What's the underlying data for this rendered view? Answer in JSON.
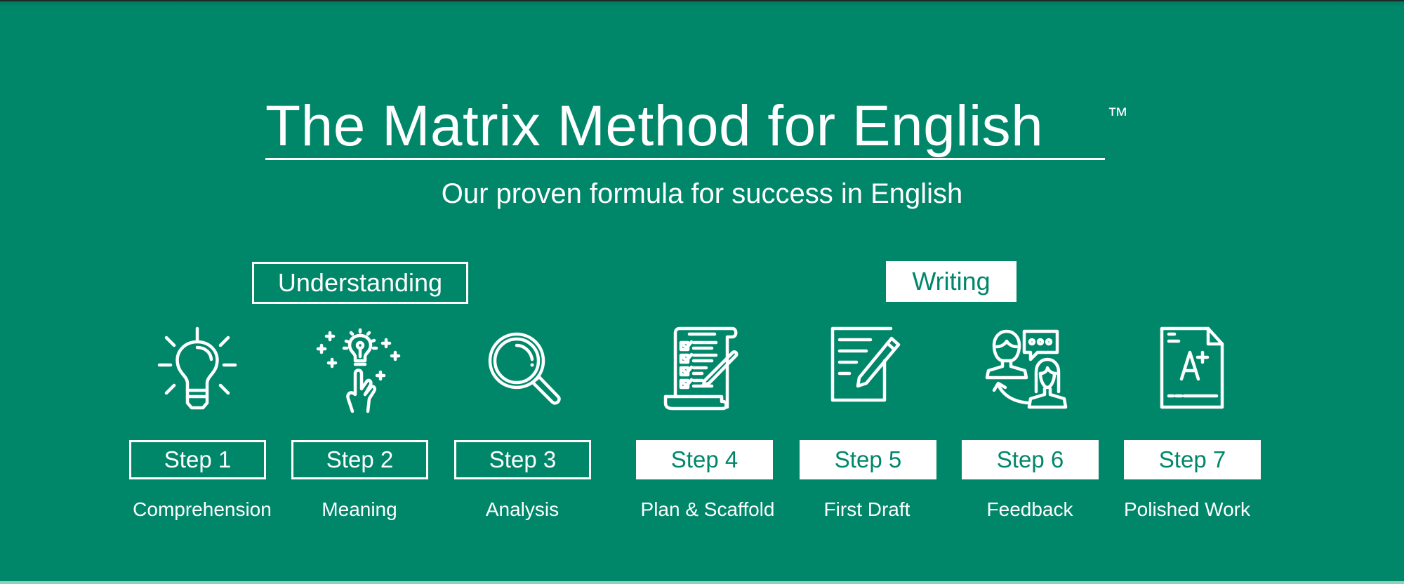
{
  "header": {
    "title": "The Matrix Method for English",
    "trademark": "™",
    "subtitle": "Our proven formula for success in English"
  },
  "groups": [
    {
      "label": "Understanding",
      "style": "outline"
    },
    {
      "label": "Writing",
      "style": "filled"
    }
  ],
  "steps": [
    {
      "label": "Step 1",
      "name": "Comprehension",
      "icon": "lightbulb-icon",
      "style": "outline"
    },
    {
      "label": "Step 2",
      "name": "Meaning",
      "icon": "idea-hand-icon",
      "style": "outline"
    },
    {
      "label": "Step 3",
      "name": "Analysis",
      "icon": "magnifying-glass-icon",
      "style": "outline"
    },
    {
      "label": "Step 4",
      "name": "Plan & Scaffold",
      "icon": "checklist-scroll-icon",
      "style": "filled"
    },
    {
      "label": "Step 5",
      "name": "First Draft",
      "icon": "document-pencil-icon",
      "style": "filled"
    },
    {
      "label": "Step 6",
      "name": "Feedback",
      "icon": "feedback-people-icon",
      "style": "filled"
    },
    {
      "label": "Step 7",
      "name": "Polished Work",
      "icon": "graded-paper-icon",
      "style": "filled"
    }
  ],
  "colors": {
    "background": "#00876A",
    "foreground": "#FFFFFF"
  }
}
